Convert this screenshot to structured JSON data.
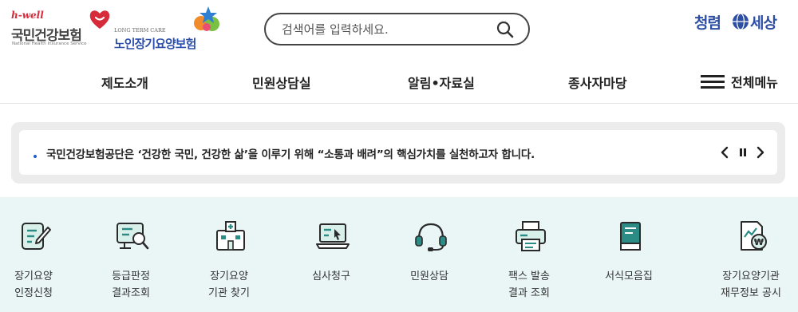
{
  "header": {
    "nhis_logo": {
      "tagline": "h-well",
      "name": "국민건강보험",
      "sub": "National Health Insurance Service"
    },
    "ltc_logo": {
      "en": "LONG TERM CARE",
      "kr": "노인장기요양보험"
    },
    "search": {
      "placeholder": "검색어를 입력하세요.",
      "icon": "search-icon"
    },
    "clean_logo": {
      "left": "청렴",
      "right": "세상"
    }
  },
  "nav": {
    "items": [
      "제도소개",
      "민원상담실",
      "알림•자료실",
      "종사자마당"
    ],
    "all_menu": "전체메뉴"
  },
  "notice": {
    "text": "국민건강보험공단은 ‘건강한 국민, 건강한 삶’을 이루기 위해 “소통과 배려”의 핵심가치를 실천하고자 합니다.",
    "controls": [
      "prev-icon",
      "pause-icon",
      "next-icon"
    ]
  },
  "quick_menu": [
    {
      "label": "장기요양\n인정신청",
      "icon": "application-pen-icon"
    },
    {
      "label": "등급판정\n결과조회",
      "icon": "monitor-search-icon"
    },
    {
      "label": "장기요양\n기관 찾기",
      "icon": "hospital-icon"
    },
    {
      "label": "심사청구",
      "icon": "laptop-cursor-icon"
    },
    {
      "label": "민원상담",
      "icon": "headset-icon"
    },
    {
      "label": "팩스 발송\n결과 조회",
      "icon": "fax-printer-icon"
    },
    {
      "label": "서식모음집",
      "icon": "book-icon"
    },
    {
      "label": "장기요양기관\n재무정보 공시",
      "icon": "finance-document-icon"
    }
  ],
  "colors": {
    "accent_teal": "#2a8c85",
    "quick_bg": "#e9f6f5",
    "brand_blue": "#2d4ea2",
    "brand_red": "#d62b3a"
  }
}
